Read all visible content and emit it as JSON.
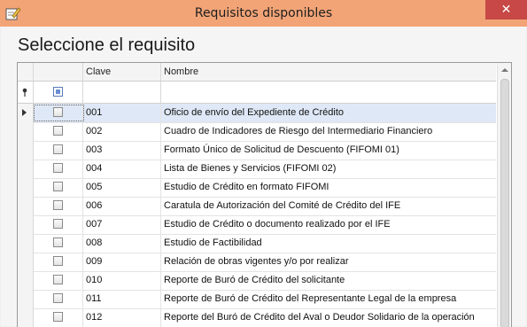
{
  "window": {
    "title": "Requisitos disponibles",
    "close_glyph": "✕"
  },
  "heading": "Seleccione el requisito",
  "grid": {
    "columns": {
      "clave": "Clave",
      "nombre": "Nombre"
    },
    "rows": [
      {
        "clave": "001",
        "nombre": "Oficio de envío del Expediente de Crédito"
      },
      {
        "clave": "002",
        "nombre": "Cuadro de Indicadores de Riesgo del Intermediario Financiero"
      },
      {
        "clave": "003",
        "nombre": "Formato Único de Solicitud de Descuento (FIFOMI 01)"
      },
      {
        "clave": "004",
        "nombre": "Lista de Bienes y Servicios (FIFOMI 02)"
      },
      {
        "clave": "005",
        "nombre": "Estudio de Crédito en formato FIFOMI"
      },
      {
        "clave": "006",
        "nombre": "Caratula de Autorización del Comité de Crédito del IFE"
      },
      {
        "clave": "007",
        "nombre": "Estudio de Crédito o documento realizado por el IFE"
      },
      {
        "clave": "008",
        "nombre": "Estudio de Factibilidad"
      },
      {
        "clave": "009",
        "nombre": "Relación de obras vigentes y/o por realizar"
      },
      {
        "clave": "010",
        "nombre": "Reporte de Buró de Crédito del solicitante"
      },
      {
        "clave": "011",
        "nombre": "Reporte de Buró de Crédito del Representante Legal de la empresa"
      },
      {
        "clave": "012",
        "nombre": "Reporte del Buró de Crédito del Aval o Deudor Solidario de la operación"
      }
    ]
  }
}
